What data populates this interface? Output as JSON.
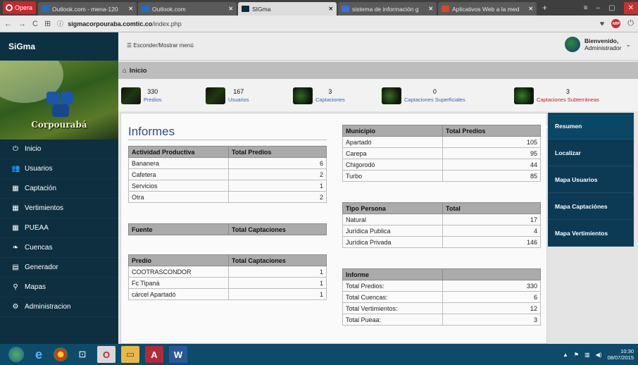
{
  "browser": {
    "opera_label": "Opera",
    "tabs": [
      {
        "title": "Outlook.com - mena-120",
        "icon_color": "#1f6fc3",
        "active": false
      },
      {
        "title": "Outlook.com",
        "icon_color": "#1f6fc3",
        "active": false
      },
      {
        "title": "SIGma",
        "icon_color": "#0a2a40",
        "active": true
      },
      {
        "title": "sistema de información g",
        "icon_color": "#3a6fd8",
        "active": false
      },
      {
        "title": "Aplicativos Web a la med",
        "icon_color": "#d34a2a",
        "active": false
      }
    ],
    "new_tab": "+",
    "url": "sigmacorpouraba.comtic.co/index.php",
    "url_domain": "sigmacorpouraba.comtic.co",
    "url_path": "/index.php"
  },
  "header": {
    "brand": "SiGma",
    "toggle_menu": "Esconder/Mostrar menú",
    "welcome": "Bienvenido,",
    "user": "Administrador"
  },
  "sidebar": {
    "logo_name": "Corpourabá",
    "items": [
      {
        "label": "Inicio",
        "icon": "power-icon",
        "glyph": "⏻"
      },
      {
        "label": "Usuarios",
        "icon": "users-icon",
        "glyph": "👥"
      },
      {
        "label": "Captación",
        "icon": "table-icon",
        "glyph": "▦"
      },
      {
        "label": "Vertimientos",
        "icon": "table-icon",
        "glyph": "▦"
      },
      {
        "label": "PUEAA",
        "icon": "table-icon",
        "glyph": "▦"
      },
      {
        "label": "Cuencas",
        "icon": "leaf-icon",
        "glyph": "❧"
      },
      {
        "label": "Generador",
        "icon": "chart-icon",
        "glyph": "▤"
      },
      {
        "label": "Mapas",
        "icon": "map-marker-icon",
        "glyph": "⚲"
      },
      {
        "label": "Administracion",
        "icon": "cogs-icon",
        "glyph": "⚙"
      }
    ]
  },
  "breadcrumb": "Inicio",
  "stats": [
    {
      "value": "330",
      "label": "Predios",
      "color": "#1c1c1c",
      "accent": "#2e66b5"
    },
    {
      "value": "167",
      "label": "Usuarios",
      "color": "#1c1c1c",
      "accent": "#2e66b5"
    },
    {
      "value": "3",
      "label": "Captaciones",
      "color": "#2f6b1e",
      "accent": "#2e66b5"
    },
    {
      "value": "0",
      "label": "Captaciones Superficiales",
      "color": "#3c6a2a",
      "accent": "#2e66b5"
    },
    {
      "value": "3",
      "label": "Captaciones Subterráneas",
      "color": "#3a7a2a",
      "accent": "#b22222"
    }
  ],
  "report": {
    "title": "Informes",
    "actividad": {
      "headers": [
        "Actividad Productiva",
        "Total Predios"
      ],
      "rows": [
        [
          "Bananera",
          "6"
        ],
        [
          "Cafetera",
          "2"
        ],
        [
          "Servicios",
          "1"
        ],
        [
          "Otra",
          "2"
        ]
      ]
    },
    "fuente": {
      "headers": [
        "Fuente",
        "Total Captaciones"
      ]
    },
    "predio": {
      "headers": [
        "Predio",
        "Total Captaciones"
      ],
      "rows": [
        [
          "COOTRASCONDOR",
          "1"
        ],
        [
          "Fc Tipaná",
          "1"
        ],
        [
          "cárcel Apartadó",
          "1"
        ]
      ]
    },
    "municipio": {
      "headers": [
        "Municipio",
        "Total Predios"
      ],
      "rows": [
        [
          "Apartadó",
          "105"
        ],
        [
          "Carepa",
          "95"
        ],
        [
          "Chigorodó",
          "44"
        ],
        [
          "Turbo",
          "85"
        ]
      ]
    },
    "tipo_persona": {
      "headers": [
        "Tipo Persona",
        "Total"
      ],
      "rows": [
        [
          "Natural",
          "17"
        ],
        [
          "Jurídica Publica",
          "4"
        ],
        [
          "Jurídica Privada",
          "146"
        ]
      ]
    },
    "informe": {
      "headers": [
        "Informe",
        ""
      ],
      "rows": [
        [
          "Total Predios:",
          "330"
        ],
        [
          "Total Cuencas:",
          "6"
        ],
        [
          "Total Vertimientos:",
          "12"
        ],
        [
          "Total Pueaa:",
          "3"
        ]
      ]
    }
  },
  "right_nav": [
    "Resumen",
    "Localizar",
    "Mapa Usuarios",
    "Mapa Captaciónes",
    "Mapa Vertimientos"
  ],
  "taskbar": {
    "time": "10:30",
    "date": "08/07/2015"
  }
}
